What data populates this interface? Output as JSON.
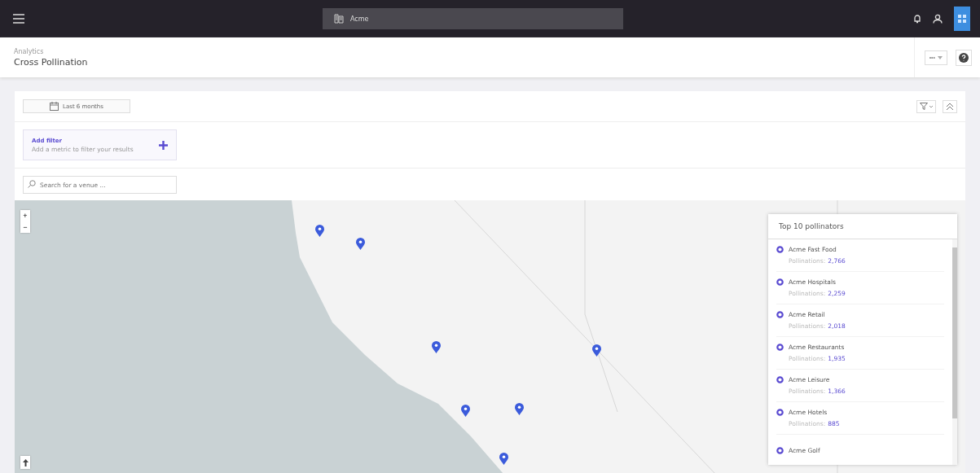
{
  "topbar": {
    "search": {
      "value": "Acme"
    }
  },
  "header": {
    "breadcrumb": "Analytics",
    "title": "Cross Pollination",
    "more_button": "•••"
  },
  "toolbar": {
    "date_range": "Last 6 months"
  },
  "add_filter": {
    "title": "Add filter",
    "subtitle": "Add a metric to filter your results"
  },
  "venue_search": {
    "placeholder": "Search for a venue ..."
  },
  "map": {
    "zoom_in": "+",
    "zoom_out": "−"
  },
  "pollinators": {
    "title": "Top 10 pollinators",
    "items": [
      {
        "name": "Acme Fast Food",
        "label": "Pollinations:",
        "count": "2,766"
      },
      {
        "name": "Acme Hospitals",
        "label": "Pollinations:",
        "count": "2,259"
      },
      {
        "name": "Acme Retail",
        "label": "Pollinations:",
        "count": "2,018"
      },
      {
        "name": "Acme Restaurants",
        "label": "Pollinations:",
        "count": "1,935"
      },
      {
        "name": "Acme Leisure",
        "label": "Pollinations:",
        "count": "1,366"
      },
      {
        "name": "Acme Hotels",
        "label": "Pollinations:",
        "count": "885"
      },
      {
        "name": "Acme Golf"
      }
    ]
  }
}
